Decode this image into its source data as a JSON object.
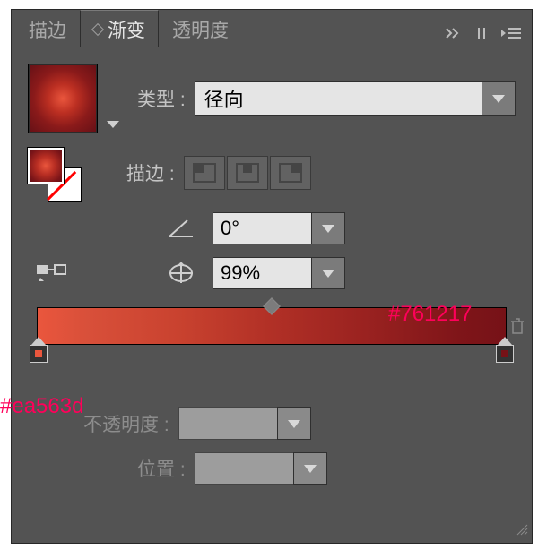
{
  "tabs": {
    "stroke": "描边",
    "gradient": "渐变",
    "transparency": "透明度"
  },
  "labels": {
    "type": "类型 :",
    "stroke": "描边 :",
    "opacity": "不透明度 :",
    "position": "位置 :"
  },
  "typeSelect": "径向",
  "angle": "0°",
  "scale": "99%",
  "stops": {
    "left": "#ea563d",
    "right": "#761217"
  },
  "annotations": {
    "left": "#ea563d",
    "right": "#761217"
  }
}
